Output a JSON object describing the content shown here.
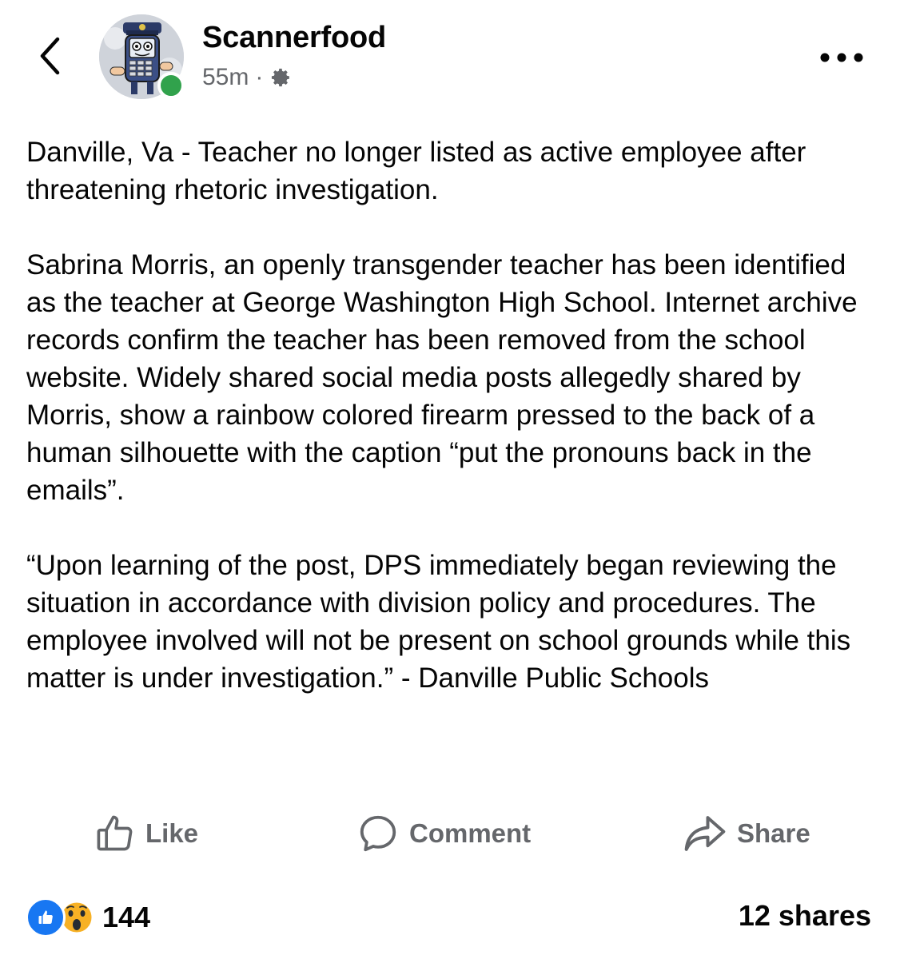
{
  "header": {
    "page_name": "Scannerfood",
    "time": "55m",
    "separator": "·",
    "audience_icon": "gear-icon",
    "back_icon": "chevron-left-icon",
    "more_icon": "more-horizontal-icon",
    "online": true
  },
  "post": {
    "paragraphs": [
      "Danville, Va - Teacher no longer listed as active employee after threatening rhetoric investigation.",
      "Sabrina Morris, an openly transgender teacher has been identified as the teacher at George Washington High School. Internet archive records confirm the teacher has been removed from the school website. Widely shared social media posts allegedly shared by Morris, show a rainbow colored firearm pressed to the back of a human silhouette with the caption “put the pronouns back in the emails”.",
      "“Upon learning of the post, DPS immediately began reviewing the situation in accordance with division policy and procedures. The employee involved will not be present on school grounds while this matter is under investigation.” - Danville Public Schools"
    ]
  },
  "actions": {
    "like_label": "Like",
    "comment_label": "Comment",
    "share_label": "Share"
  },
  "footer": {
    "reaction_count": "144",
    "reaction_icons": [
      "like-reaction-icon",
      "wow-reaction-icon"
    ],
    "shares_label": "12 shares"
  },
  "colors": {
    "text": "#050505",
    "secondary": "#65676b",
    "online_green": "#31a24c",
    "like_blue": "#1877f2",
    "wow_yellow": "#f7b125"
  }
}
